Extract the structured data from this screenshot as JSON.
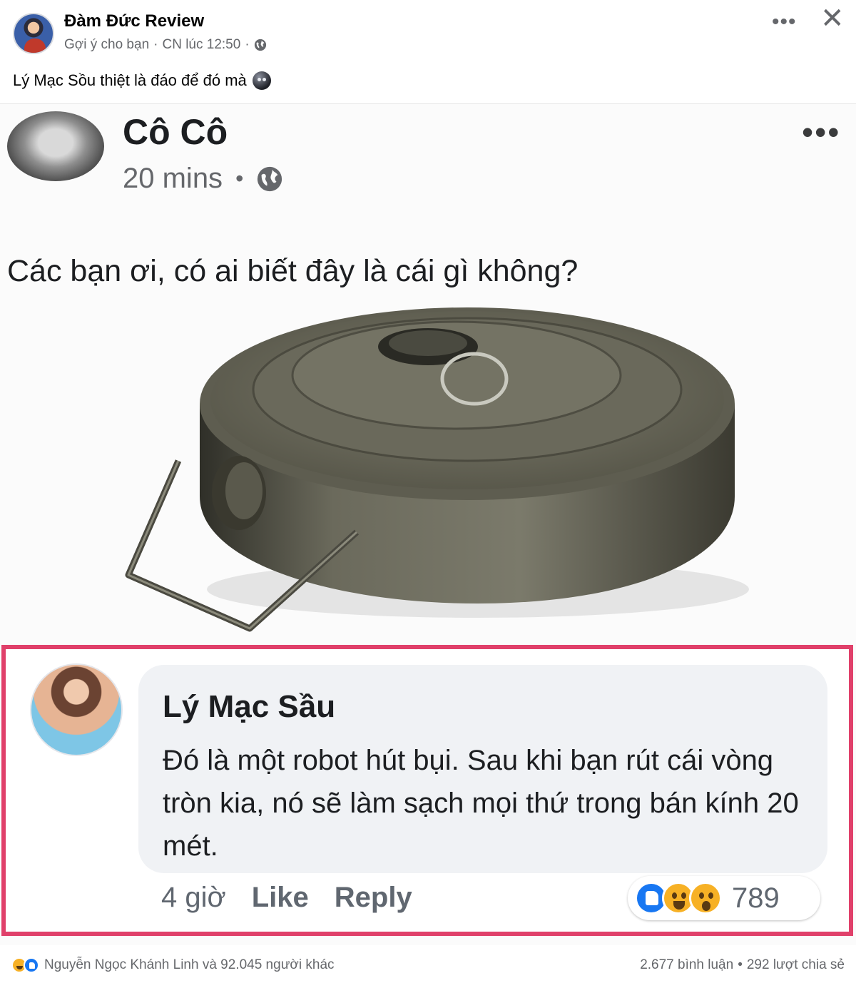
{
  "post": {
    "page_name": "Đàm Đức Review",
    "suggested": "Gợi ý cho bạn",
    "time": "CN lúc 12:50",
    "separator": "·",
    "caption": "Lý Mạc Sồu thiệt là đáo để đó mà"
  },
  "icons": {
    "more": "more-icon",
    "close": "close-icon",
    "globe": "globe-icon",
    "emoji": "dark-moon-emoji"
  },
  "embedded": {
    "author": "Cô Cô",
    "time": "20 mins",
    "separator": "•",
    "question": "Các bạn ơi, có ai biết đây là cái gì không?",
    "comment": {
      "author": "Lý Mạc Sầu",
      "text": "Đó là một robot hút bụi. Sau khi bạn rút cái vòng tròn kia, nó sẽ làm sạch mọi thứ trong bán kính 20 mét.",
      "time": "4 giờ",
      "like_label": "Like",
      "reply_label": "Reply",
      "reaction_count": "789"
    },
    "highlight_color": "#e0406a"
  },
  "footer": {
    "likers": "Nguyễn Ngọc Khánh Linh và 92.045 người khác",
    "comments": "2.677 bình luận",
    "separator": "•",
    "shares": "292 lượt chia sẻ"
  },
  "colors": {
    "secondary_text": "#65676b",
    "like_blue": "#1877f2",
    "reaction_yellow": "#f7b125"
  }
}
